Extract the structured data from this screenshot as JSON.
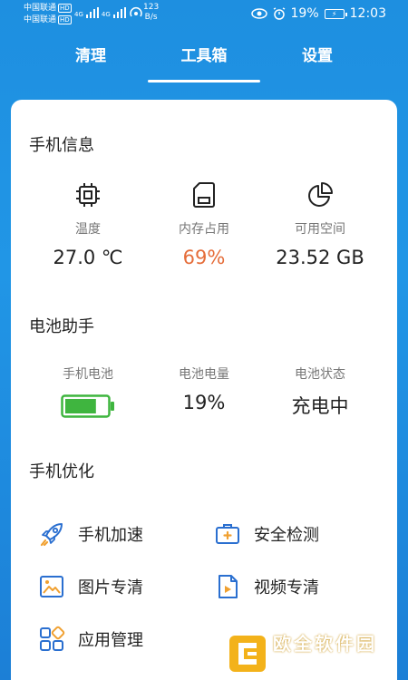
{
  "status_bar": {
    "carrier1": "中国联通",
    "carrier2": "中国联通",
    "hd": "HD",
    "net1": "4G",
    "net2": "4G",
    "speed_value": "123",
    "speed_unit": "B/s",
    "battery_percent": "19%",
    "time": "12:03"
  },
  "tabs": [
    {
      "label": "清理"
    },
    {
      "label": "工具箱"
    },
    {
      "label": "设置"
    }
  ],
  "phone_info": {
    "title": "手机信息",
    "items": [
      {
        "label": "温度",
        "value": "27.0 ℃",
        "icon": "chip-icon"
      },
      {
        "label": "内存占用",
        "value": "69%",
        "icon": "sd-card-icon"
      },
      {
        "label": "可用空间",
        "value": "23.52 GB",
        "icon": "pie-chart-icon"
      }
    ]
  },
  "battery_helper": {
    "title": "电池助手",
    "items": [
      {
        "label": "手机电池",
        "icon": "battery-icon",
        "level": 0.75
      },
      {
        "label": "电池电量",
        "value": "19%"
      },
      {
        "label": "电池状态",
        "value": "充电中"
      }
    ]
  },
  "optimize": {
    "title": "手机优化",
    "items": [
      {
        "label": "手机加速",
        "icon": "rocket-icon"
      },
      {
        "label": "安全检测",
        "icon": "toolbox-icon"
      },
      {
        "label": "图片专清",
        "icon": "image-icon"
      },
      {
        "label": "视频专清",
        "icon": "video-file-icon"
      },
      {
        "label": "应用管理",
        "icon": "apps-grid-icon"
      }
    ]
  },
  "watermark": {
    "text": "欧全软件园",
    "url": "www.apoujin.com"
  },
  "colors": {
    "accent_blue": "#2196e6",
    "icon_orange": "#f0a030",
    "battery_green": "#3fb53f",
    "memory_value_orange": "#e56d3a"
  }
}
